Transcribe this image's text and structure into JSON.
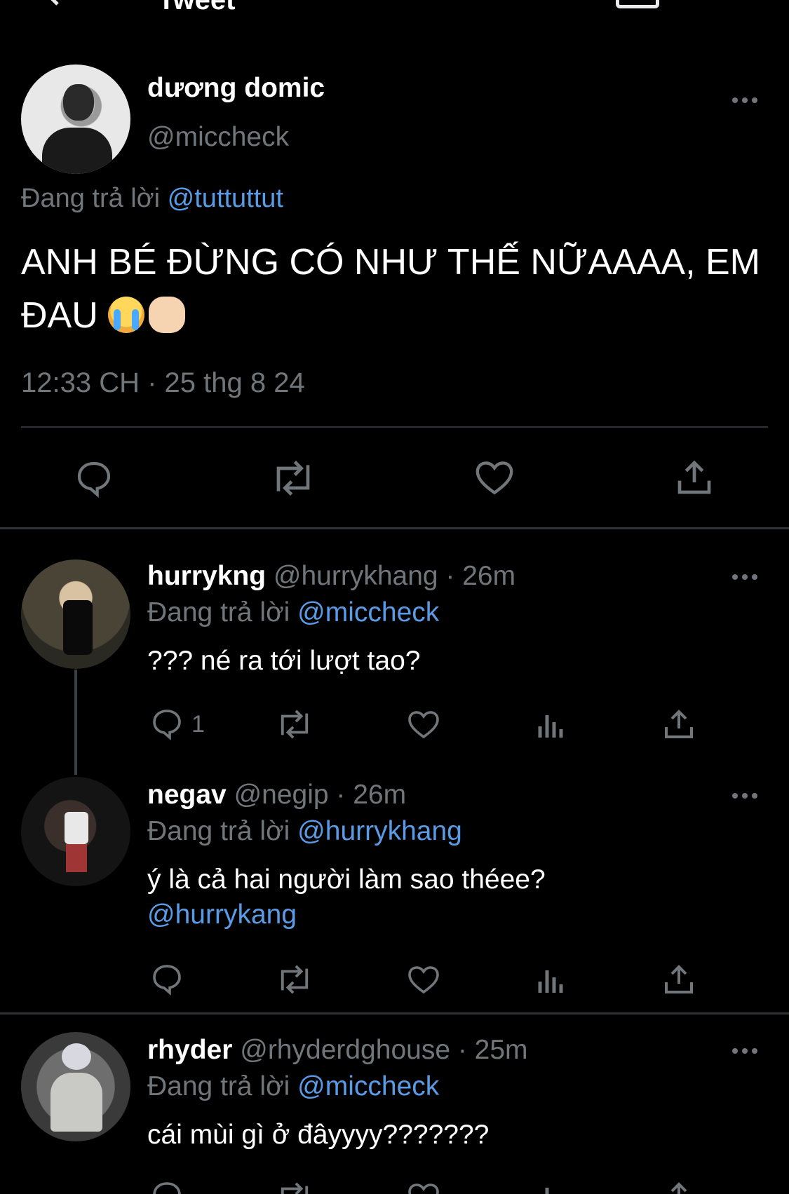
{
  "topbar": {
    "title": "Tweet"
  },
  "main_tweet": {
    "display_name": "dương domic",
    "handle": "@miccheck",
    "reply_prefix": "Đang trả lời",
    "reply_to": "@tuttuttut",
    "text_line1": "ANH BÉ ĐỪNG CÓ NHƯ THẾ NỮAAAA, EM",
    "text_line2": "ĐAU",
    "emojis": [
      "loudly-crying-face",
      "backhand-index-pointing-right"
    ],
    "timestamp": "12:33 CH · 25 thg 8 24"
  },
  "replies": [
    {
      "display_name": "hurrykng",
      "meta": "@hurrykhang · 26m",
      "reply_prefix": "Đang trả lời",
      "reply_to": "@miccheck",
      "text": "??? né ra tới lượt tao?",
      "reply_count": "1"
    },
    {
      "display_name": "negav",
      "meta": "@negip · 26m",
      "reply_prefix": "Đang trả lời",
      "reply_to": "@hurrykhang",
      "text": "ý là cả hai người làm sao théee?",
      "mention": "@hurrykang"
    },
    {
      "display_name": "rhyder",
      "meta": "@rhyderdghouse · 25m",
      "reply_prefix": "Đang trả lời",
      "reply_to": "@miccheck",
      "text": "cái mùi gì ở đâyyyy???????"
    }
  ],
  "colors": {
    "background": "#000000",
    "muted": "#71767b",
    "link": "#5a9be6",
    "divider": "#2f3336"
  }
}
